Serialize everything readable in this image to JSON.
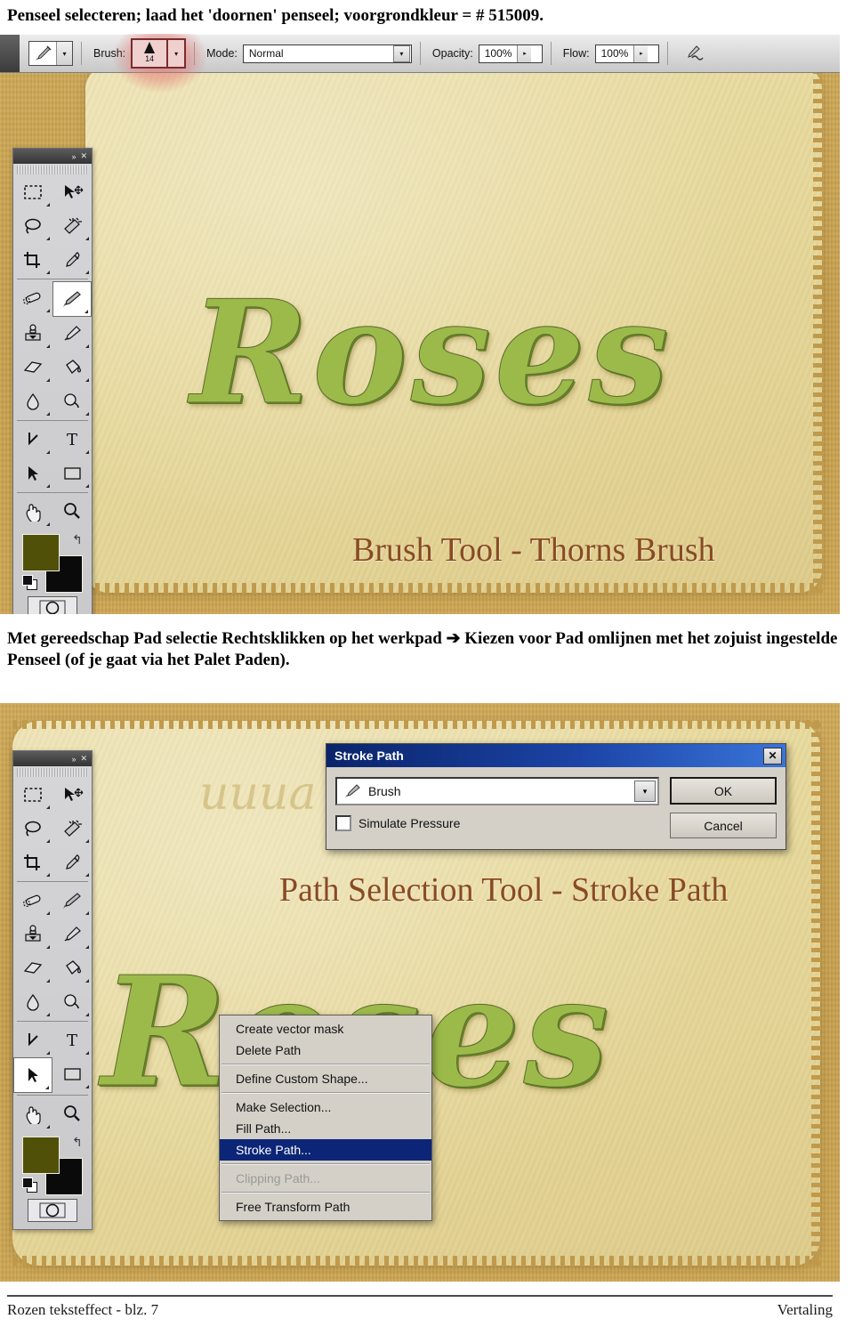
{
  "document": {
    "header_text": "Penseel selecteren; laad het 'doornen' penseel; voorgrondkleur = # 515009.",
    "body_text": "Met gereedschap Pad selectie Rechtsklikken op het werkpad ➔ Kiezen voor Pad omlijnen met het zojuist ingestelde Penseel (of je gaat via het Palet Paden).",
    "footer_left": "Rozen teksteffect - blz. 7",
    "footer_right": "Vertaling"
  },
  "colors": {
    "foreground_swatch": "#515009",
    "background_swatch": "#0a0a0a",
    "kraft": "#cda653",
    "paper": "#e6d79a",
    "caption_brown": "#8a4b22",
    "menu_highlight": "#0c2577",
    "titlebar_blue": "#0a246a"
  },
  "options_bar": {
    "tool_icon": "paintbrush-icon",
    "tool_preset_arrow": "▾",
    "brush_label": "Brush:",
    "brush_size": "14",
    "brush_tip_icon": "soft-round-tip-icon",
    "brush_arrow": "▾",
    "mode_label": "Mode:",
    "mode_value": "Normal",
    "mode_arrow": "▾",
    "opacity_label": "Opacity:",
    "opacity_value": "100%",
    "opacity_arrow": "▸",
    "flow_label": "Flow:",
    "flow_value": "100%",
    "flow_arrow": "▸",
    "airbrush_icon": "airbrush-icon"
  },
  "toolbox": {
    "collapse_glyph": "»",
    "close_glyph": "✕",
    "tools": [
      {
        "name": "rectangular-marquee-tool",
        "has_corner": true
      },
      {
        "name": "move-tool",
        "has_corner": false
      },
      {
        "name": "lasso-tool",
        "has_corner": true
      },
      {
        "name": "magic-wand-tool",
        "has_corner": true
      },
      {
        "name": "crop-tool",
        "has_corner": true
      },
      {
        "name": "eyedropper-tool",
        "has_corner": true
      },
      {
        "name": "healing-brush-tool",
        "has_corner": true
      },
      {
        "name": "brush-tool",
        "has_corner": true
      },
      {
        "name": "clone-stamp-tool",
        "has_corner": true
      },
      {
        "name": "history-brush-tool",
        "has_corner": true
      },
      {
        "name": "eraser-tool",
        "has_corner": true
      },
      {
        "name": "paint-bucket-tool",
        "has_corner": true
      },
      {
        "name": "blur-tool",
        "has_corner": true
      },
      {
        "name": "dodge-tool",
        "has_corner": true
      },
      {
        "name": "pen-tool",
        "has_corner": true
      },
      {
        "name": "type-tool",
        "has_corner": true
      },
      {
        "name": "path-selection-tool",
        "has_corner": true
      },
      {
        "name": "rectangle-shape-tool",
        "has_corner": true
      },
      {
        "name": "hand-tool",
        "has_corner": true
      },
      {
        "name": "zoom-tool",
        "has_corner": false
      }
    ],
    "top_active_tool": "brush-tool",
    "bottom_active_tool": "path-selection-tool",
    "swap_glyph": "↰",
    "quickmask_icon": "quick-mask-icon"
  },
  "figure_top": {
    "artwork_word": "Roses",
    "caption": "Brush Tool - Thorns Brush"
  },
  "figure_bottom": {
    "artwork_word": "Roses",
    "caption": "Path Selection Tool - Stroke Path",
    "watermark": "uuua"
  },
  "stroke_path_dialog": {
    "title": "Stroke Path",
    "close_glyph": "✕",
    "tool_value": "Brush",
    "tool_icon": "paintbrush-icon",
    "dropdown_arrow": "▾",
    "checkbox_label": "Simulate Pressure",
    "checkbox_checked": false,
    "ok_label": "OK",
    "cancel_label": "Cancel"
  },
  "context_menu": {
    "items": [
      {
        "label": "Create vector mask",
        "state": "normal"
      },
      {
        "label": "Delete Path",
        "state": "normal"
      },
      {
        "label": "SEPARATOR",
        "state": "separator"
      },
      {
        "label": "Define Custom Shape...",
        "state": "normal"
      },
      {
        "label": "SEPARATOR",
        "state": "separator"
      },
      {
        "label": "Make Selection...",
        "state": "normal"
      },
      {
        "label": "Fill Path...",
        "state": "normal"
      },
      {
        "label": "Stroke Path...",
        "state": "selected"
      },
      {
        "label": "SEPARATOR",
        "state": "separator"
      },
      {
        "label": "Clipping Path...",
        "state": "disabled"
      },
      {
        "label": "SEPARATOR",
        "state": "separator"
      },
      {
        "label": "Free Transform Path",
        "state": "normal"
      }
    ]
  }
}
